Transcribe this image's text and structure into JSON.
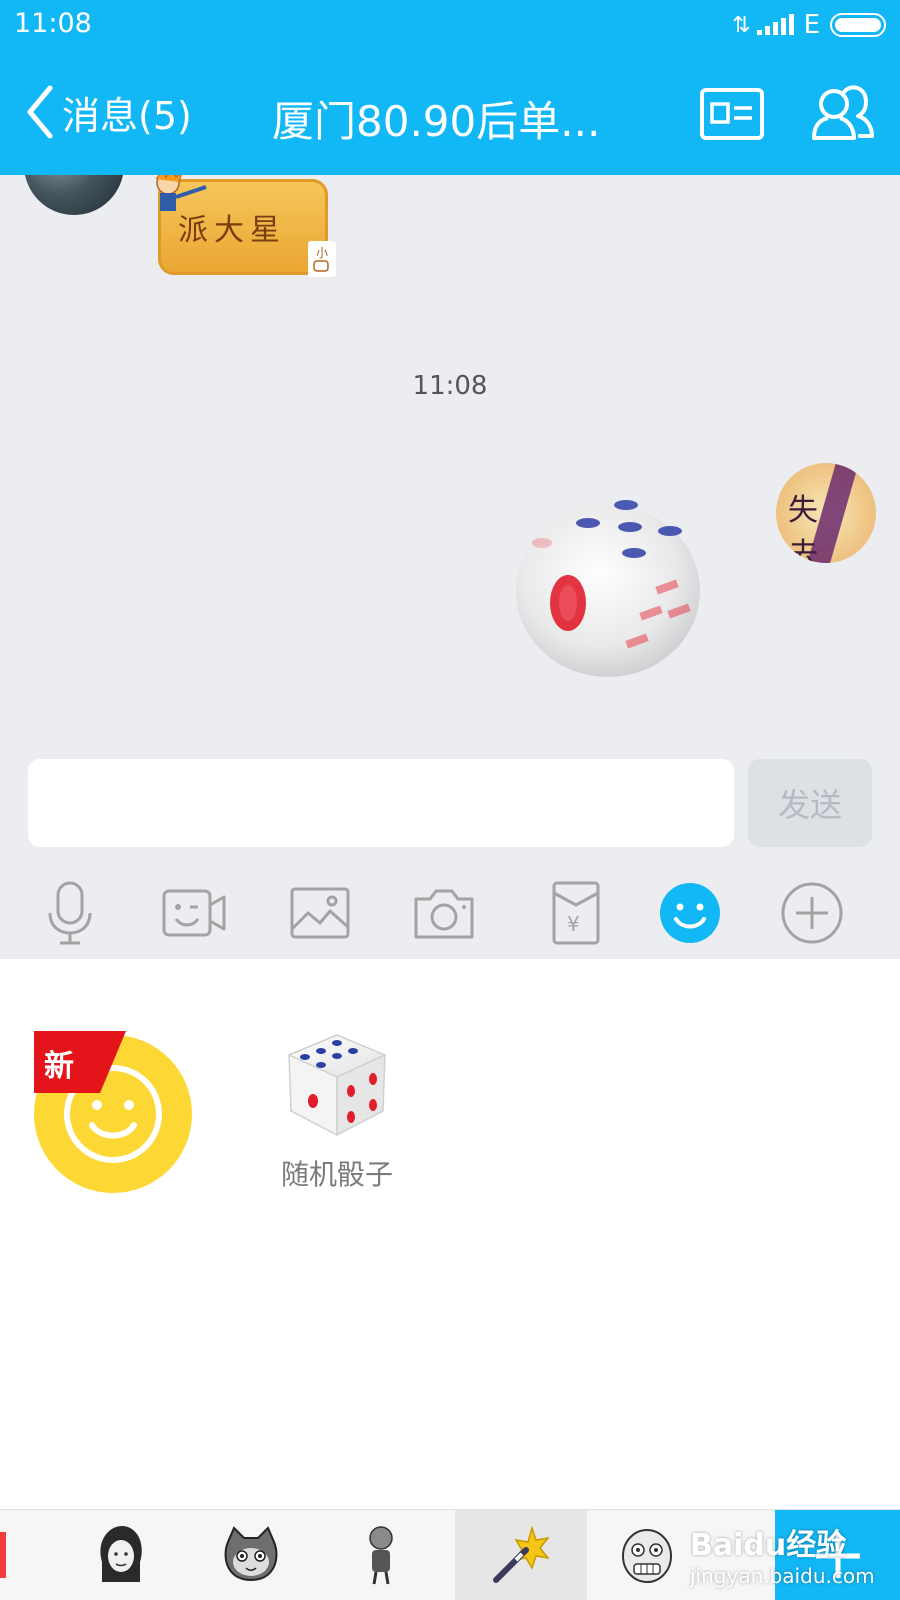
{
  "status_bar": {
    "time": "11:08",
    "network_type": "E"
  },
  "header": {
    "back_label": "消息(5)",
    "title": "厦门80.90后单...",
    "icons": [
      "back-chevron-icon",
      "profile-card-icon",
      "group-members-icon"
    ]
  },
  "chat": {
    "incoming_sticker_text": "派大星",
    "timestamp": "11:08",
    "my_avatar_text": "失 去",
    "outgoing_message": "dice-roll-animation"
  },
  "composer": {
    "input_value": "",
    "send_label": "发送"
  },
  "toolbar": {
    "items": [
      "microphone-icon",
      "video-emoji-icon",
      "image-icon",
      "camera-icon",
      "red-packet-icon",
      "emoji-icon",
      "plus-icon"
    ],
    "active": "emoji-icon",
    "accent_color": "#12b7f5"
  },
  "emoji_panel": {
    "new_badge": "新",
    "dice_label": "随机骰子"
  },
  "tray": {
    "items": [
      "girl-sticker-icon",
      "cat-sticker-icon",
      "figure-sticker-icon",
      "magic-wand-icon",
      "funny-face-icon"
    ],
    "selected": "magic-wand-icon"
  },
  "watermark": {
    "brand": "Baidu经验",
    "url": "jingyan.baidu.com"
  }
}
